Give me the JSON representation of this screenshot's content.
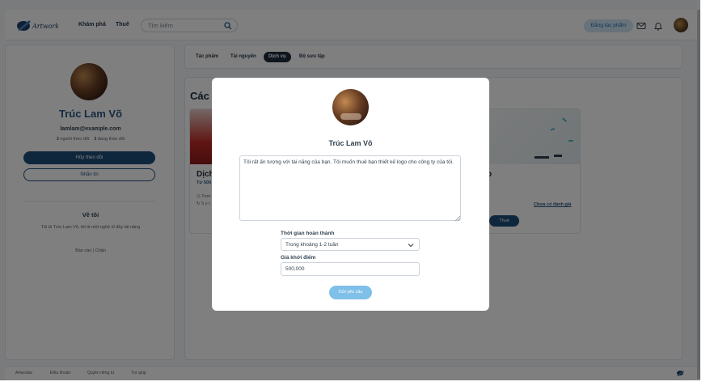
{
  "topbar": {
    "nav": [
      "Khám phá",
      "Thuê"
    ],
    "search_placeholder": "Tìm kiếm",
    "post_button": "Đăng tác phẩm"
  },
  "profile": {
    "name": "Trúc Lam Võ",
    "email": "lamlam@example.com",
    "followers_count": "3",
    "followers_label": "người theo dõi",
    "following_count": "3",
    "following_label": "đang theo dõi",
    "unfollow_button": "Hủy theo dõi",
    "message_button": "Nhắn tin",
    "about_title": "Về tôi",
    "about_text": "Tôi là Trúc Lam Võ, tôi là một nghệ sĩ đầy tài năng",
    "report_link": "Báo cáo",
    "block_link": "Chặn"
  },
  "tabs": [
    "Tác phẩm",
    "Tài nguyên",
    "Dịch vụ",
    "Bộ sưu tập"
  ],
  "active_tab": "Dịch vụ",
  "services": {
    "title_partial": "Các d",
    "card_left_title": "Dịch",
    "card_left_price": "Từ 500",
    "card_left_meta1": "Tron",
    "card_left_meta2": "5 y t",
    "card_right_title": "o",
    "review_link": "Chưa có đánh giá",
    "hire_button": "Thuê"
  },
  "footer": {
    "links": [
      "Artworkia",
      "Điều khoản",
      "Quyền riêng tư",
      "Trợ giúp"
    ]
  },
  "modal": {
    "name": "Trúc Lam Võ",
    "message": "Tôi rất ấn tượng với tài năng của bạn. Tôi muốn thuê bạn thiết kế logo cho công ty của tôi.",
    "deadline_label": "Thời gian hoàn thành",
    "deadline_value": "Trong khoảng 1-2 tuần",
    "price_label": "Giá khởi điểm",
    "price_value": "500,000",
    "submit_button": "Gửi yêu cầu"
  },
  "colors": {
    "primary": "#1f4f7a",
    "accent_light": "#7ec0e8",
    "name_color": "#2a5680"
  }
}
